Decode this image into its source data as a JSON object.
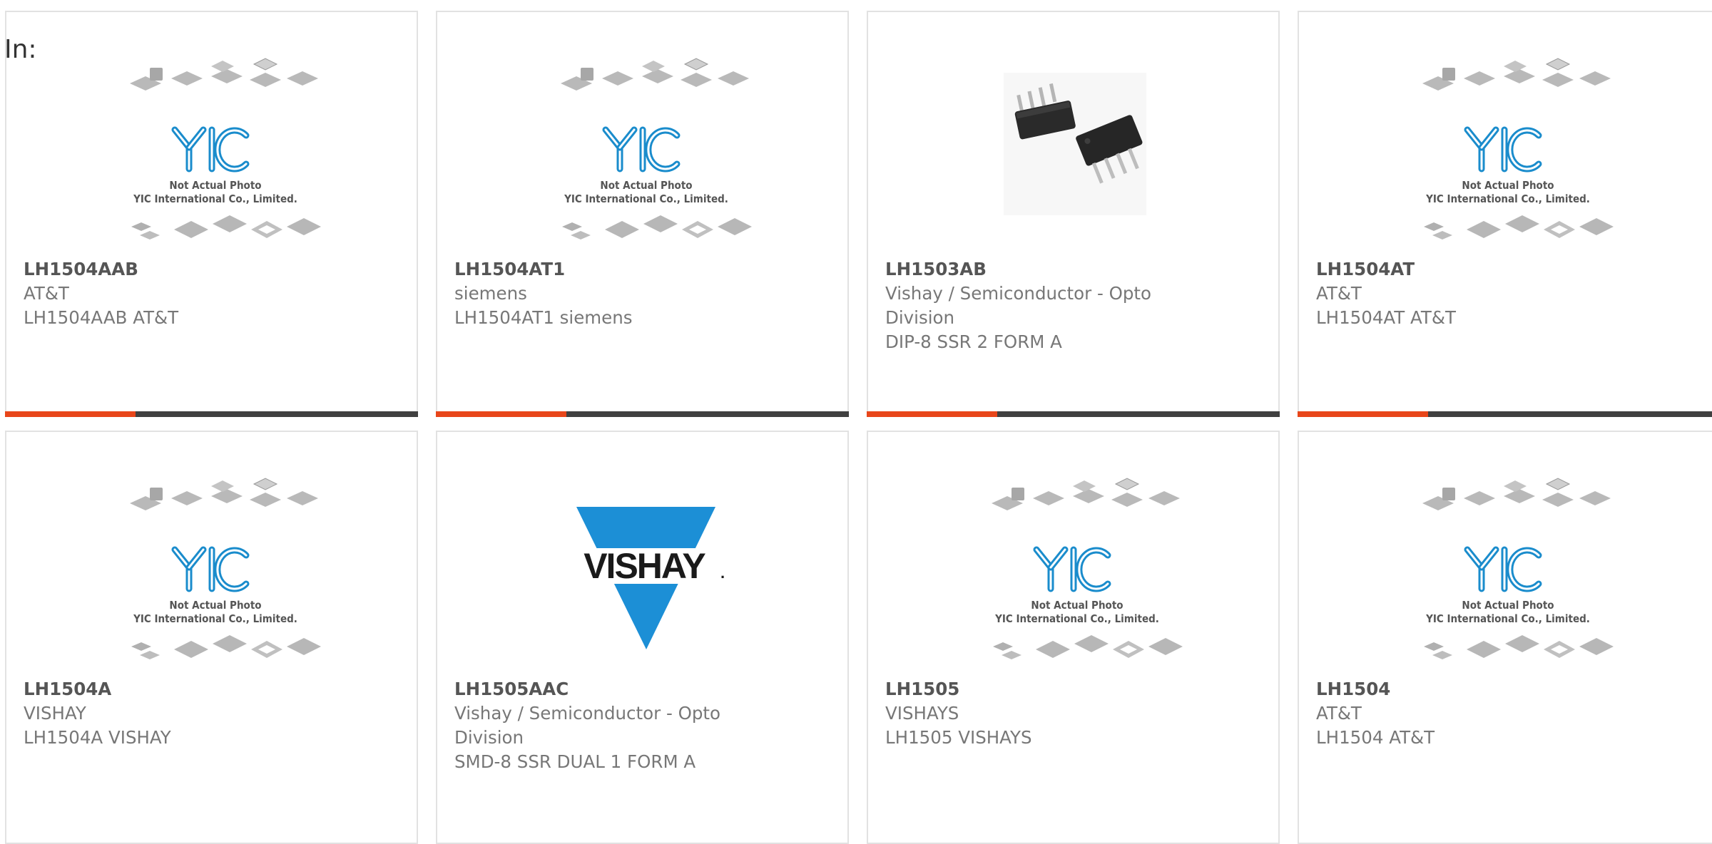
{
  "filter": {
    "label": "In:"
  },
  "placeholder_image": {
    "caption_line1": "Not Actual Photo",
    "caption_line2": "YIC International Co., Limited.",
    "logo_text": "YIC"
  },
  "vishay_logo": {
    "text": "VISHAY",
    "mark": "."
  },
  "colors": {
    "accent_bar": "#e8461a",
    "dark_bar": "#404040",
    "logo_blue": "#1a8ccc",
    "vishay_blue": "#1c8fd6"
  },
  "products": [
    {
      "part_number": "LH1504AAB",
      "manufacturer": "AT&T",
      "description": "LH1504AAB AT&T",
      "image": "placeholder"
    },
    {
      "part_number": "LH1504AT1",
      "manufacturer": "siemens",
      "description": "LH1504AT1 siemens",
      "image": "placeholder"
    },
    {
      "part_number": "LH1503AB",
      "manufacturer": "Vishay / Semiconductor - Opto Division",
      "description": "DIP-8 SSR 2 FORM A",
      "image": "dip8-chips"
    },
    {
      "part_number": "LH1504AT",
      "manufacturer": "AT&T",
      "description": "LH1504AT AT&T",
      "image": "placeholder"
    },
    {
      "part_number": "LH1504A",
      "manufacturer": "VISHAY",
      "description": "LH1504A VISHAY",
      "image": "placeholder"
    },
    {
      "part_number": "LH1505AAC",
      "manufacturer": "Vishay / Semiconductor - Opto Division",
      "description": "SMD-8 SSR DUAL 1 FORM A",
      "image": "vishay-logo"
    },
    {
      "part_number": "LH1505",
      "manufacturer": "VISHAYS",
      "description": "LH1505 VISHAYS",
      "image": "placeholder"
    },
    {
      "part_number": "LH1504",
      "manufacturer": "AT&T",
      "description": "LH1504 AT&T",
      "image": "placeholder"
    }
  ]
}
